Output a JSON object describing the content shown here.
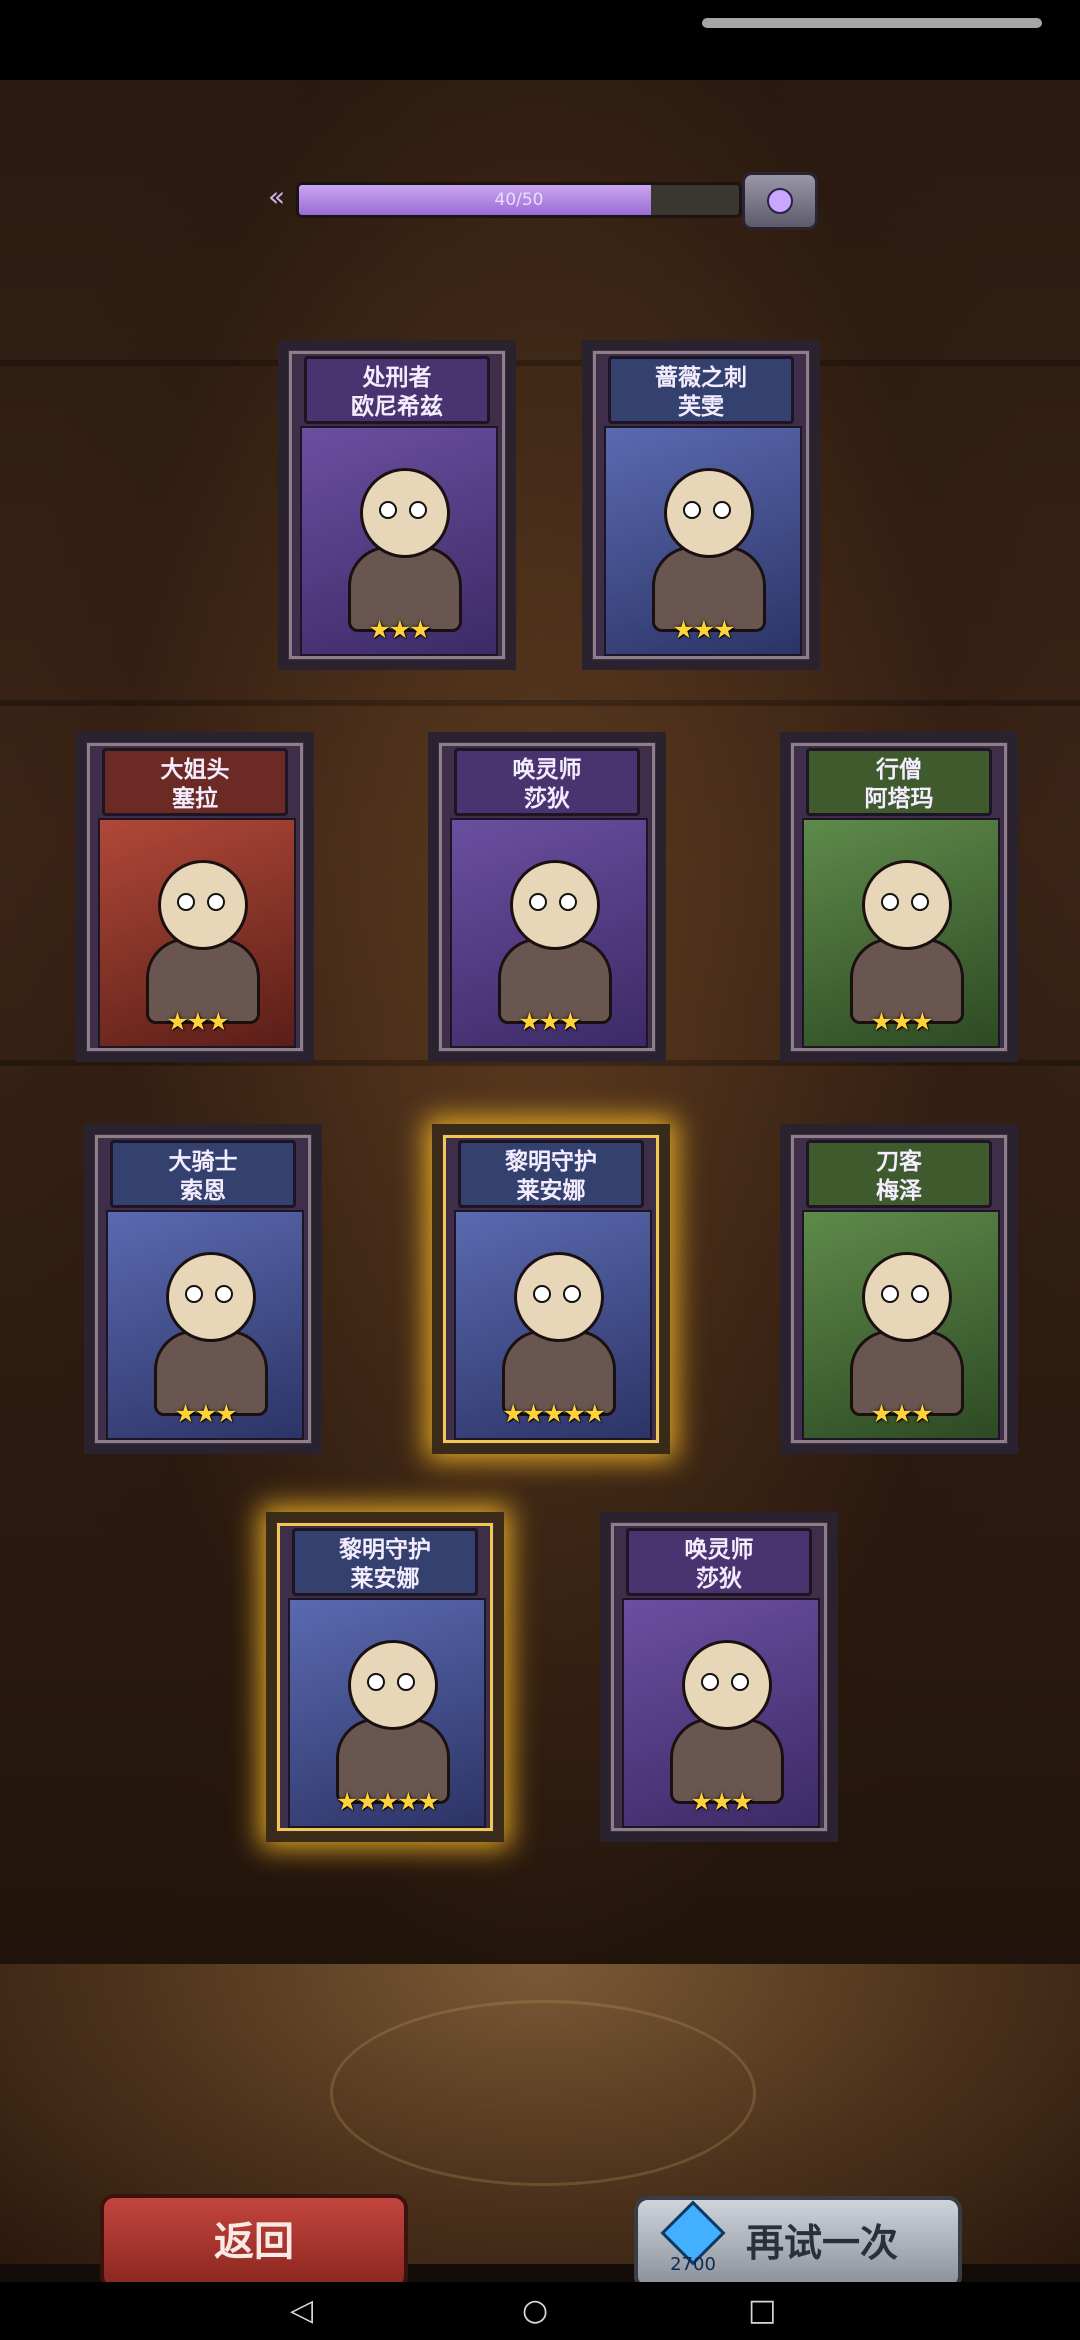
{
  "progress": {
    "value": 40,
    "max": 50,
    "label": "40/50"
  },
  "cards": [
    {
      "title_line1": "处刑者",
      "title_line2": "欧尼希兹",
      "stars": "★★★",
      "theme": "purple",
      "highlight": false
    },
    {
      "title_line1": "蔷薇之刺",
      "title_line2": "芙雯",
      "stars": "★★★",
      "theme": "blue",
      "highlight": false
    },
    {
      "title_line1": "大姐头",
      "title_line2": "塞拉",
      "stars": "★★★",
      "theme": "red",
      "highlight": false
    },
    {
      "title_line1": "唤灵师",
      "title_line2": "莎狄",
      "stars": "★★★",
      "theme": "purple",
      "highlight": false
    },
    {
      "title_line1": "行僧",
      "title_line2": "阿塔玛",
      "stars": "★★★",
      "theme": "green",
      "highlight": false
    },
    {
      "title_line1": "大骑士",
      "title_line2": "索恩",
      "stars": "★★★",
      "theme": "blue",
      "highlight": false
    },
    {
      "title_line1": "黎明守护",
      "title_line2": "莱安娜",
      "stars": "★★★★★",
      "theme": "blue",
      "highlight": true
    },
    {
      "title_line1": "刀客",
      "title_line2": "梅泽",
      "stars": "★★★",
      "theme": "green",
      "highlight": false
    },
    {
      "title_line1": "黎明守护",
      "title_line2": "莱安娜",
      "stars": "★★★★★",
      "theme": "blue",
      "highlight": true
    },
    {
      "title_line1": "唤灵师",
      "title_line2": "莎狄",
      "stars": "★★★",
      "theme": "purple",
      "highlight": false
    }
  ],
  "buttons": {
    "back_label": "返回",
    "retry_label": "再试一次",
    "retry_cost": "2700"
  },
  "icons": {
    "progress_arrow": "«",
    "chest": "chest-icon",
    "diamond": "diamond-icon",
    "nav_back": "◁",
    "nav_home": "○",
    "nav_recent": "□"
  },
  "colors": {
    "gold_glow": "#ffbe28",
    "progress_fill": "#b183e4",
    "back_button": "#b03a32",
    "retry_button": "#b8bcc4"
  }
}
